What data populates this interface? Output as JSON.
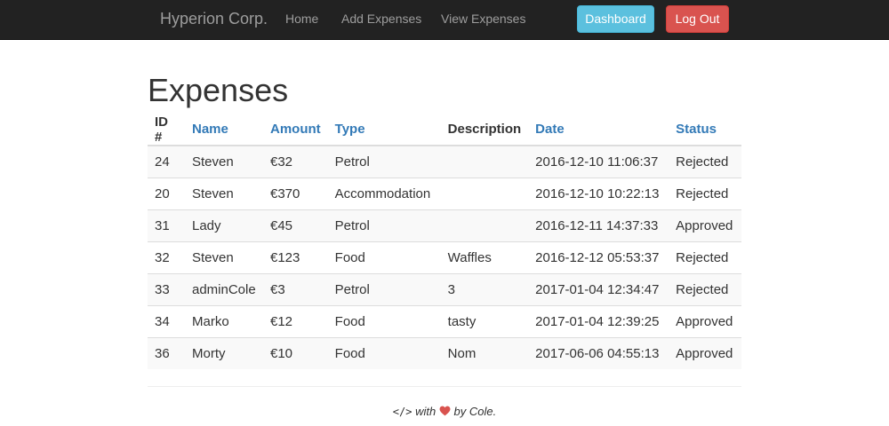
{
  "navbar": {
    "brand": "Hyperion Corp.",
    "links": [
      "Home",
      "Add Expenses",
      "View Expenses"
    ],
    "dashboard_label": "Dashboard",
    "logout_label": "Log Out"
  },
  "page": {
    "title": "Expenses"
  },
  "table": {
    "headers": [
      "ID #",
      "Name",
      "Amount",
      "Type",
      "Description",
      "Date",
      "Status"
    ],
    "rows": [
      [
        "24",
        "Steven",
        "€32",
        "Petrol",
        "",
        "2016-12-10 11:06:37",
        "Rejected"
      ],
      [
        "20",
        "Steven",
        "€370",
        "Accommodation",
        "",
        "2016-12-10 10:22:13",
        "Rejected"
      ],
      [
        "31",
        "Lady",
        "€45",
        "Petrol",
        "",
        "2016-12-11 14:37:33",
        "Approved"
      ],
      [
        "32",
        "Steven",
        "€123",
        "Food",
        "Waffles",
        "2016-12-12 05:53:37",
        "Rejected"
      ],
      [
        "33",
        "adminCole",
        "€3",
        "Petrol",
        "3",
        "2017-01-04 12:34:47",
        "Rejected"
      ],
      [
        "34",
        "Marko",
        "€12",
        "Food",
        "tasty",
        "2017-01-04 12:39:25",
        "Approved"
      ],
      [
        "36",
        "Morty",
        "€10",
        "Food",
        "Nom",
        "2017-06-06 04:55:13",
        "Approved"
      ]
    ]
  },
  "footer": {
    "code_glyph": "</>",
    "with_text": "with",
    "by_text": "by Cole.",
    "heart_icon": "heart-icon",
    "heart_color": "#d9534f"
  },
  "colors": {
    "navbar_bg": "#222222",
    "link_blue": "#337ab7",
    "info_button": "#5bc0de",
    "danger_button": "#d9534f"
  }
}
